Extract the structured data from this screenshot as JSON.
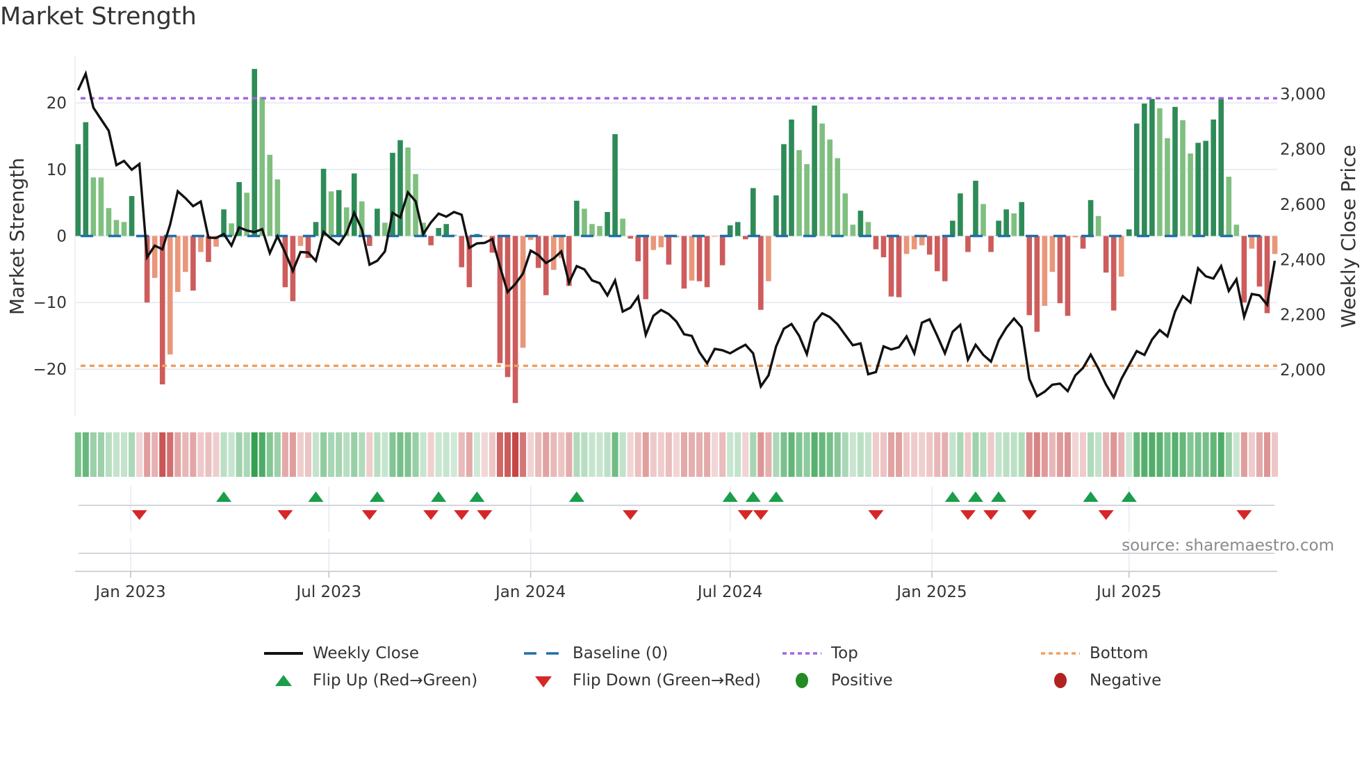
{
  "title": "Market Strength",
  "source_note": "source: sharemaestro.com",
  "colors": {
    "strong_green": "#2e8b57",
    "weak_green": "#7fbf7f",
    "strong_red": "#cd5c5c",
    "weak_red": "#e9967a",
    "price_line": "#111111",
    "baseline": "#1f6fa8",
    "top": "#a066e0",
    "bottom": "#f0a060",
    "flip_up": "#1a9e4a",
    "flip_down": "#d62728",
    "positive": "#228b22",
    "negative": "#b22222",
    "grid": "#e9edf3"
  },
  "legend": [
    {
      "key": "weekly_close",
      "label": "Weekly Close"
    },
    {
      "key": "baseline",
      "label": "Baseline (0)"
    },
    {
      "key": "top",
      "label": "Top"
    },
    {
      "key": "bottom",
      "label": "Bottom"
    },
    {
      "key": "flip_up",
      "label": "Flip Up (Red→Green)"
    },
    {
      "key": "flip_down",
      "label": "Flip Down (Green→Red)"
    },
    {
      "key": "positive",
      "label": "Positive"
    },
    {
      "key": "negative",
      "label": "Negative"
    }
  ],
  "chart_data": {
    "type": "bar",
    "title": "Market Strength",
    "ylabel": "Market Strength",
    "y2label": "Weekly Close Price",
    "ylim": [
      -27,
      27
    ],
    "y2lim": [
      1834,
      3136
    ],
    "grid": true,
    "legend_position": "bottom",
    "top_level": 20.7,
    "bottom_level": -19.5,
    "baseline": 0,
    "y_ticks": [
      {
        "value": 20,
        "label": "20"
      },
      {
        "value": 10,
        "label": "10"
      },
      {
        "value": 0,
        "label": "0"
      },
      {
        "value": -10,
        "label": "−10"
      },
      {
        "value": -20,
        "label": "−20"
      }
    ],
    "y2_ticks": [
      {
        "value": 3000,
        "label": "3,000"
      },
      {
        "value": 2800,
        "label": "2,800"
      },
      {
        "value": 2600,
        "label": "2,600"
      },
      {
        "value": 2400,
        "label": "2,400"
      },
      {
        "value": 2200,
        "label": "2,200"
      },
      {
        "value": 2000,
        "label": "2,000"
      }
    ],
    "x_ticks": [
      {
        "week": 6.86,
        "label": "Jan 2023"
      },
      {
        "week": 32.7,
        "label": "Jul 2023"
      },
      {
        "week": 59.0,
        "label": "Jan 2024"
      },
      {
        "week": 85.0,
        "label": "Jul 2024"
      },
      {
        "week": 111.3,
        "label": "Jan 2025"
      },
      {
        "week": 137.0,
        "label": "Jul 2025"
      }
    ],
    "strength": [
      13.8,
      17.1,
      8.8,
      8.8,
      4.2,
      2.4,
      2.1,
      6.0,
      -0.2,
      -10.0,
      -6.3,
      -22.3,
      -17.8,
      -8.4,
      -5.4,
      -8.2,
      -2.4,
      -3.9,
      -1.6,
      4.0,
      1.9,
      8.1,
      6.5,
      25.1,
      20.9,
      12.2,
      8.5,
      -7.7,
      -9.8,
      -1.5,
      -3.3,
      2.1,
      10.1,
      6.7,
      6.9,
      4.3,
      9.4,
      5.2,
      -1.5,
      4.1,
      2.0,
      12.5,
      14.4,
      13.3,
      9.3,
      2.0,
      -1.4,
      1.2,
      1.8,
      0.2,
      -4.7,
      -7.7,
      0.3,
      -0.1,
      -2.5,
      -19.1,
      -21.2,
      -25.1,
      -16.8,
      -0.6,
      -4.8,
      -8.9,
      -5.1,
      -3.3,
      -7.5,
      5.3,
      4.1,
      1.8,
      1.5,
      3.6,
      15.3,
      2.6,
      -0.4,
      -3.8,
      -9.5,
      -2.1,
      -1.7,
      -4.3,
      -0.2,
      -7.9,
      -6.7,
      -6.8,
      -7.7,
      -0.1,
      -4.4,
      1.6,
      2.1,
      -0.5,
      7.2,
      -11.1,
      -6.8,
      6.1,
      13.8,
      17.5,
      12.9,
      10.8,
      19.6,
      16.9,
      14.5,
      11.7,
      6.4,
      1.7,
      3.8,
      2.1,
      -2.0,
      -3.2,
      -9.1,
      -9.2,
      -2.7,
      -2.0,
      -1.4,
      -2.8,
      -5.3,
      -6.8,
      2.3,
      6.4,
      -2.4,
      8.3,
      4.8,
      -2.4,
      2.3,
      4.0,
      3.4,
      5.1,
      -11.9,
      -14.4,
      -10.5,
      -5.4,
      -10.1,
      -12.0,
      -0.2,
      -1.9,
      5.4,
      3.0,
      -5.5,
      -11.2,
      -6.1,
      1.0,
      16.9,
      19.9,
      20.6,
      19.2,
      14.7,
      19.4,
      17.4,
      12.4,
      14.0,
      14.3,
      17.5,
      20.8,
      8.9,
      1.7,
      -10.0,
      -1.9,
      -7.6,
      -11.6,
      -2.7
    ],
    "strong": [
      1,
      1,
      0,
      0,
      0,
      0,
      0,
      1,
      0,
      1,
      0,
      1,
      0,
      0,
      0,
      1,
      0,
      1,
      0,
      1,
      0,
      1,
      0,
      1,
      0,
      0,
      0,
      1,
      1,
      0,
      1,
      1,
      1,
      0,
      1,
      0,
      1,
      0,
      1,
      1,
      0,
      1,
      1,
      0,
      0,
      0,
      1,
      1,
      1,
      0,
      1,
      1,
      1,
      0,
      1,
      1,
      1,
      1,
      0,
      0,
      1,
      1,
      0,
      0,
      1,
      1,
      0,
      0,
      0,
      1,
      1,
      0,
      1,
      1,
      1,
      0,
      0,
      1,
      0,
      1,
      0,
      1,
      1,
      0,
      1,
      1,
      1,
      1,
      1,
      1,
      0,
      1,
      1,
      1,
      0,
      0,
      1,
      0,
      0,
      0,
      0,
      0,
      1,
      0,
      1,
      1,
      1,
      1,
      0,
      0,
      0,
      1,
      1,
      1,
      1,
      1,
      1,
      1,
      0,
      1,
      1,
      1,
      0,
      1,
      1,
      1,
      0,
      0,
      1,
      1,
      0,
      1,
      1,
      0,
      1,
      1,
      0,
      1,
      1,
      1,
      1,
      0,
      0,
      1,
      0,
      0,
      1,
      1,
      1,
      1,
      0,
      0,
      1,
      0,
      1,
      1,
      0
    ],
    "weekly_close": [
      3013,
      3073,
      2950,
      2908,
      2866,
      2742,
      2757,
      2725,
      2746,
      2408,
      2450,
      2437,
      2526,
      2647,
      2622,
      2593,
      2610,
      2479,
      2478,
      2492,
      2450,
      2516,
      2505,
      2499,
      2510,
      2423,
      2484,
      2425,
      2358,
      2427,
      2425,
      2395,
      2500,
      2475,
      2454,
      2496,
      2569,
      2509,
      2381,
      2395,
      2429,
      2569,
      2552,
      2643,
      2611,
      2492,
      2534,
      2566,
      2555,
      2572,
      2562,
      2442,
      2458,
      2460,
      2474,
      2374,
      2282,
      2311,
      2349,
      2432,
      2416,
      2387,
      2404,
      2429,
      2316,
      2376,
      2364,
      2324,
      2314,
      2270,
      2324,
      2211,
      2225,
      2265,
      2127,
      2196,
      2217,
      2202,
      2175,
      2129,
      2123,
      2064,
      2024,
      2076,
      2071,
      2060,
      2076,
      2091,
      2060,
      1940,
      1980,
      2085,
      2149,
      2166,
      2123,
      2057,
      2171,
      2205,
      2191,
      2165,
      2127,
      2089,
      2096,
      1984,
      1992,
      2085,
      2074,
      2082,
      2121,
      2060,
      2171,
      2183,
      2123,
      2060,
      2138,
      2163,
      2037,
      2091,
      2054,
      2030,
      2106,
      2152,
      2186,
      2154,
      1967,
      1904,
      1921,
      1946,
      1950,
      1923,
      1980,
      2007,
      2055,
      2005,
      1946,
      1900,
      1967,
      2018,
      2068,
      2054,
      2110,
      2144,
      2121,
      2211,
      2267,
      2244,
      2368,
      2339,
      2331,
      2376,
      2286,
      2328,
      2192,
      2275,
      2270,
      2236,
      2395
    ],
    "flip_up_weeks": [
      19,
      31,
      39,
      47,
      52,
      65,
      85,
      88,
      91,
      114,
      117,
      120,
      132,
      137
    ],
    "flip_down_weeks": [
      8,
      27,
      38,
      46,
      50,
      53,
      72,
      87,
      89,
      104,
      116,
      119,
      124,
      134,
      152
    ]
  }
}
